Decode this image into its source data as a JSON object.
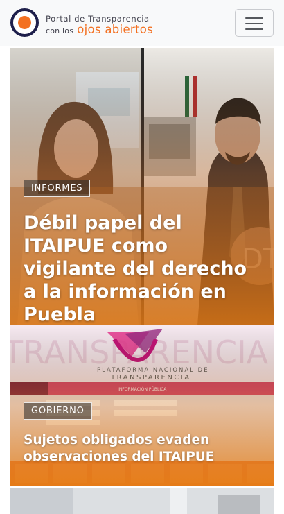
{
  "navbar": {
    "brand_line1": "Portal de Transparencia",
    "brand_prefix": "con los",
    "brand_highlight": "ojos abiertos",
    "menu_icon": "hamburger-menu-icon"
  },
  "articles": [
    {
      "category": "INFORMES",
      "title": "Débil papel del ITAIPUE como vigilante del derecho a la información en Puebla"
    },
    {
      "category": "GOBIERNO",
      "title": "Sujetos obligados evaden observaciones del ITAIPUE",
      "image_text": {
        "platform_line1": "PLATAFORMA NACIONAL DE",
        "platform_line2": "TRANSPARENCIA",
        "background_word": "TRANSPARENCIA",
        "menu_label": "INFORMACIÓN PÚBLICA"
      }
    }
  ],
  "colors": {
    "brand_orange": "#f37021",
    "brand_navy": "#1e1f4b"
  }
}
